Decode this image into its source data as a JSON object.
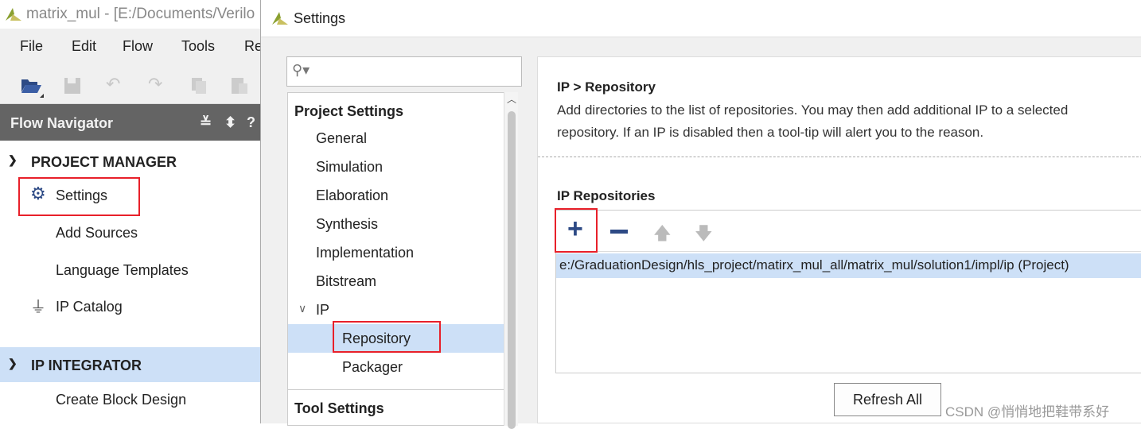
{
  "main_window": {
    "title": "matrix_mul - [E:/Documents/Verilo",
    "menu": [
      "File",
      "Edit",
      "Flow",
      "Tools",
      "Re"
    ],
    "toolbar_icons": [
      "open-folder-icon",
      "save-icon",
      "undo-icon",
      "redo-icon",
      "copy-icon",
      "paste-icon"
    ],
    "flow_navigator": {
      "title": "Flow Navigator",
      "sections": [
        {
          "label": "PROJECT MANAGER",
          "items": [
            "Settings",
            "Add Sources",
            "Language Templates",
            "IP Catalog"
          ]
        },
        {
          "label": "IP INTEGRATOR",
          "items": [
            "Create Block Design"
          ]
        }
      ]
    }
  },
  "dialog": {
    "title": "Settings",
    "search_placeholder": "",
    "tree": {
      "project_settings": "Project Settings",
      "items": [
        "General",
        "Simulation",
        "Elaboration",
        "Synthesis",
        "Implementation",
        "Bitstream"
      ],
      "ip": "IP",
      "ip_children": [
        "Repository",
        "Packager"
      ],
      "tool_settings": "Tool Settings"
    },
    "panel": {
      "breadcrumb": "IP > Repository",
      "description_line1": "Add directories to the list of repositories. You may then add additional IP to a selected",
      "description_line2": "repository. If an IP is disabled then a tool-tip will alert you to the reason.",
      "repos_title": "IP Repositories",
      "repos": [
        "e:/GraduationDesign/hls_project/matirx_mul_all/matrix_mul/solution1/impl/ip (Project)"
      ],
      "refresh_label": "Refresh All"
    }
  },
  "watermark": "CSDN @悄悄地把鞋带系好",
  "colors": {
    "accent_blue": "#2d4a85",
    "selection": "#cde0f7",
    "highlight_box": "#e8202a",
    "nav_header": "#646464"
  }
}
